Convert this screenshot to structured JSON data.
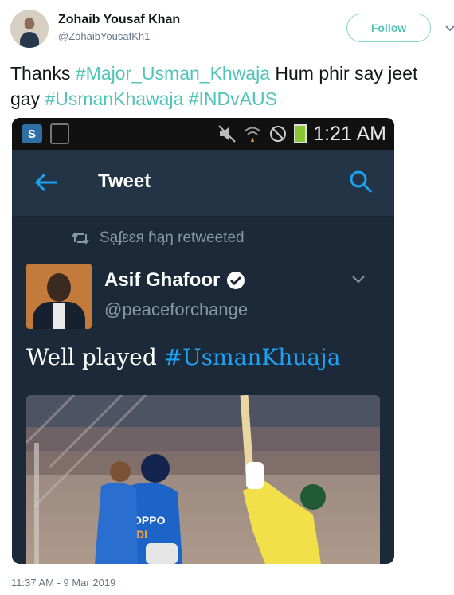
{
  "author": {
    "name": "Zohaib Yousaf Khan",
    "handle": "@ZohaibYousafKh1"
  },
  "follow_label": "Follow",
  "tweet": {
    "segments": [
      {
        "text": "Thanks ",
        "tag": false
      },
      {
        "text": "#Major_Usman_Khwaja",
        "tag": true
      },
      {
        "text": " Hum phir say jeet gay ",
        "tag": false
      },
      {
        "text": "#UsmanKhawaja",
        "tag": true
      },
      {
        "text": " ",
        "tag": false
      },
      {
        "text": "#INDvAUS",
        "tag": true
      }
    ]
  },
  "screenshot": {
    "status_bar": {
      "time": "1:21 AM"
    },
    "appbar": {
      "title": "Tweet"
    },
    "retweeted_by": "Sạʄɛɛя ɦąŋ retweeted",
    "original_author": {
      "name": "Asif Ghafoor",
      "handle": "@peaceforchange"
    },
    "text_prefix": "Well played ",
    "hashtag": "#UsmanKhuaja",
    "photo": {
      "jerseys": [
        "OPPO",
        "INDI"
      ]
    }
  },
  "timestamp": "11:37 AM - 9 Mar 2019",
  "colors": {
    "hashtag": "#4fc5b8",
    "card_bg": "#1c2938",
    "appbar_bg": "#243447",
    "link_blue": "#1da1f2"
  }
}
